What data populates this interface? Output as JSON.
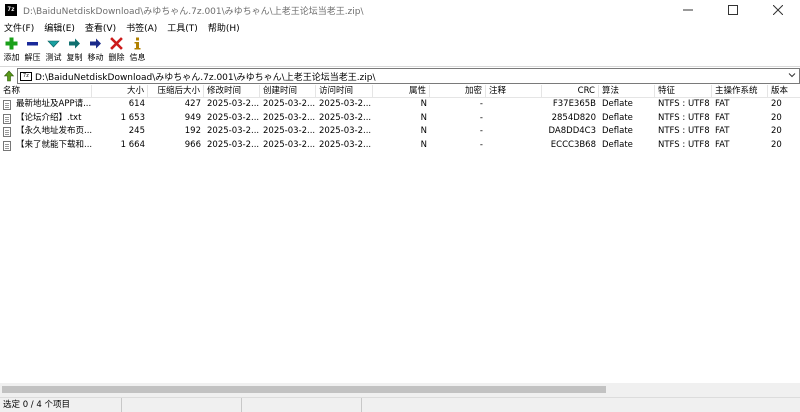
{
  "window": {
    "title": "D:\\BaiduNetdiskDownload\\みゆちゃん.7z.001\\みゆちゃん\\上老王论坛当老王.zip\\",
    "app_icon_text": "7z"
  },
  "menu": [
    "文件(F)",
    "编辑(E)",
    "查看(V)",
    "书签(A)",
    "工具(T)",
    "帮助(H)"
  ],
  "toolbar": [
    {
      "label": "添加",
      "icon": "plus-icon",
      "color": "#1aa01a"
    },
    {
      "label": "解压",
      "icon": "minus-icon",
      "color": "#1a2a9a"
    },
    {
      "label": "测试",
      "icon": "checkmark-icon",
      "color": "#1aa0a0"
    },
    {
      "label": "复制",
      "icon": "arrow-right-icon",
      "color": "#107070"
    },
    {
      "label": "移动",
      "icon": "arrow-right-icon",
      "color": "#1a2a8a"
    },
    {
      "label": "删除",
      "icon": "x-icon",
      "color": "#cc1a1a"
    },
    {
      "label": "信息",
      "icon": "info-icon",
      "color": "#b08000"
    }
  ],
  "address": {
    "path": "D:\\BaiduNetdiskDownload\\みゆちゃん.7z.001\\みゆちゃん\\上老王论坛当老王.zip\\",
    "drive_icon_text": "7z"
  },
  "columns": [
    "名称",
    "大小",
    "压缩后大小",
    "修改时间",
    "创建时间",
    "访问时间",
    "属性",
    "加密",
    "注释",
    "CRC",
    "算法",
    "特征",
    "主操作系统",
    "版本"
  ],
  "rows": [
    {
      "name": "最新地址及APP请...",
      "size": "614",
      "packed": "427",
      "modified": "2025-03-2...",
      "created": "2025-03-2...",
      "accessed": "2025-03-2...",
      "attr": "N",
      "encrypted": "-",
      "comment": "",
      "crc": "F37E365B",
      "method": "Deflate",
      "characteristics": "NTFS : UTF8",
      "host_os": "FAT",
      "version": "20"
    },
    {
      "name": "【论坛介绍】.txt",
      "size": "1 653",
      "packed": "949",
      "modified": "2025-03-2...",
      "created": "2025-03-2...",
      "accessed": "2025-03-2...",
      "attr": "N",
      "encrypted": "-",
      "comment": "",
      "crc": "2854D820",
      "method": "Deflate",
      "characteristics": "NTFS : UTF8",
      "host_os": "FAT",
      "version": "20"
    },
    {
      "name": "【永久地址发布页...",
      "size": "245",
      "packed": "192",
      "modified": "2025-03-2...",
      "created": "2025-03-2...",
      "accessed": "2025-03-2...",
      "attr": "N",
      "encrypted": "-",
      "comment": "",
      "crc": "DA8DD4C3",
      "method": "Deflate",
      "characteristics": "NTFS : UTF8",
      "host_os": "FAT",
      "version": "20"
    },
    {
      "name": "【来了就能下载和...",
      "size": "1 664",
      "packed": "966",
      "modified": "2025-03-2...",
      "created": "2025-03-2...",
      "accessed": "2025-03-2...",
      "attr": "N",
      "encrypted": "-",
      "comment": "",
      "crc": "ECCC3B68",
      "method": "Deflate",
      "characteristics": "NTFS : UTF8",
      "host_os": "FAT",
      "version": "20"
    }
  ],
  "status": {
    "selection": "选定 0 / 4 个项目"
  }
}
